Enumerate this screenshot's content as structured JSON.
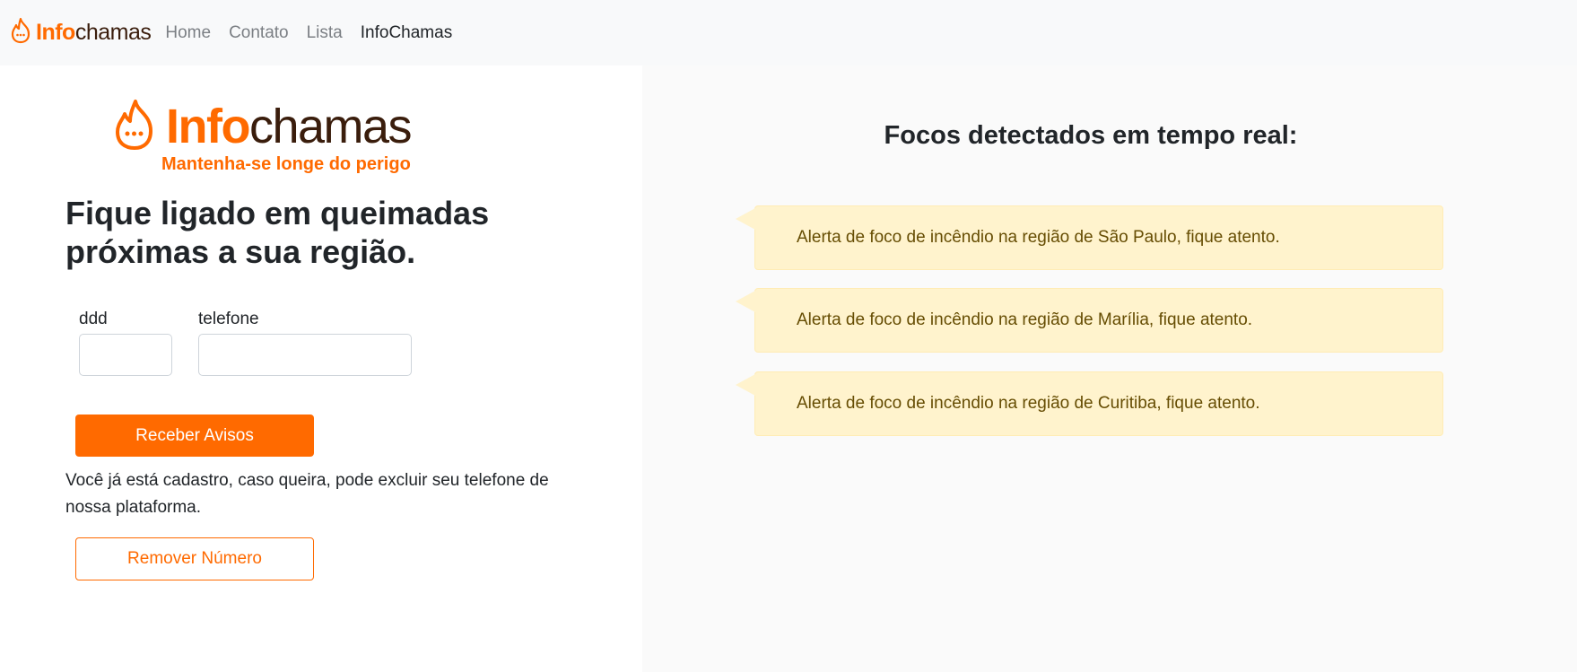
{
  "nav": {
    "brand_info": "Info",
    "brand_chamas": "chamas",
    "links": [
      {
        "label": "Home"
      },
      {
        "label": "Contato"
      },
      {
        "label": "Lista"
      },
      {
        "label": "InfoChamas"
      }
    ]
  },
  "logo": {
    "info": "Info",
    "chamas": "chamas",
    "slogan": "Mantenha-se longe do perigo"
  },
  "headline": "Fique ligado em queimadas próximas a sua região.",
  "form": {
    "ddd_label": "ddd",
    "ddd_value": "",
    "telefone_label": "telefone",
    "telefone_value": ""
  },
  "buttons": {
    "receber": "Receber Avisos",
    "remover": "Remover Número"
  },
  "info_text": "Você já está cadastro, caso queira, pode excluir seu telefone de nossa plataforma.",
  "focos": {
    "title": "Focos detectados em tempo real:",
    "alerts": [
      "Alerta de foco de incêndio na região de São Paulo, fique atento.",
      "Alerta de foco de incêndio na região de Marília, fique atento.",
      "Alerta de foco de incêndio na região de Curitiba, fique atento."
    ]
  },
  "colors": {
    "brand_orange": "#ff6a00",
    "brand_brown": "#3a1d0c",
    "alert_bg": "#fff3cd",
    "alert_text": "#664d03"
  }
}
